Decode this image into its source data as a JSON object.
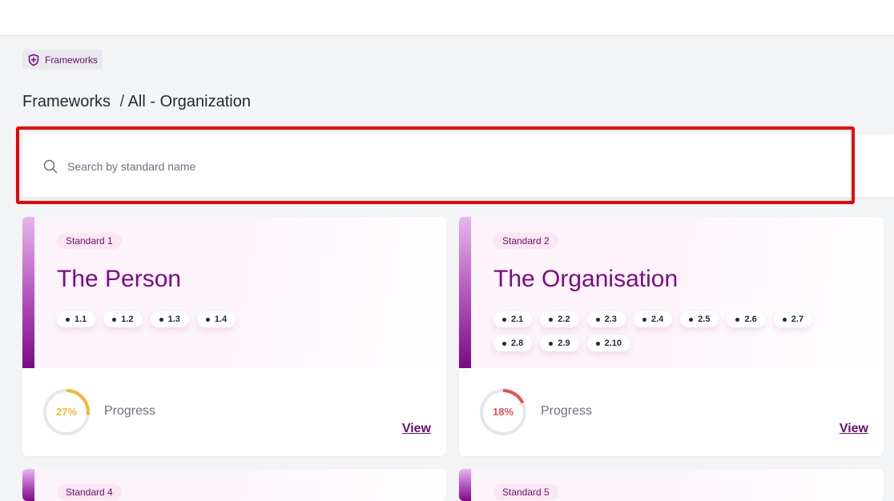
{
  "breadcrumb": {
    "chip_label": "Frameworks"
  },
  "page_title": {
    "primary": "Frameworks",
    "separator": "/",
    "secondary": "All - Organization"
  },
  "search": {
    "placeholder": "Search by standard name",
    "value": ""
  },
  "progress_label": "Progress",
  "view_label": "View",
  "cards": [
    {
      "badge": "Standard 1",
      "title": "The Person",
      "chips": [
        "1.1",
        "1.2",
        "1.3",
        "1.4"
      ],
      "progress_text": "27%",
      "progress_value": 27,
      "progress_color": "#f2b82f"
    },
    {
      "badge": "Standard 2",
      "title": "The Organisation",
      "chips": [
        "2.1",
        "2.2",
        "2.3",
        "2.4",
        "2.5",
        "2.6",
        "2.7",
        "2.8",
        "2.9",
        "2.10"
      ],
      "progress_text": "18%",
      "progress_value": 18,
      "progress_color": "#ef4d4d"
    },
    {
      "badge": "Standard 4"
    },
    {
      "badge": "Standard 5"
    }
  ],
  "colors": {
    "brand": "#7d0a86",
    "highlight_outline": "#ee0000",
    "ring_track": "#e5e7eb"
  },
  "icons": {
    "breadcrumb": "shield-plus-icon",
    "search": "search-icon"
  }
}
